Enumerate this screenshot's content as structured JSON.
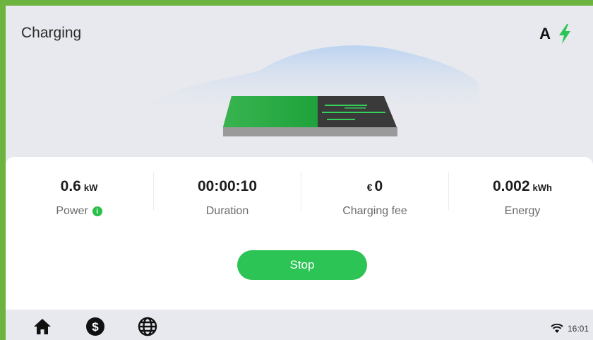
{
  "header": {
    "title": "Charging",
    "connector_letter": "A",
    "bolt_icon": "lightning-bolt-icon"
  },
  "metrics": [
    {
      "value": "0.6",
      "unit": "kW",
      "label": "Power",
      "info_icon": "info-icon"
    },
    {
      "value": "00:00:10",
      "unit": "",
      "label": "Duration"
    },
    {
      "value": "0",
      "currency": "€",
      "label": "Charging fee"
    },
    {
      "value": "0.002",
      "unit": "kWh",
      "label": "Energy"
    }
  ],
  "actions": {
    "stop_label": "Stop"
  },
  "nav": {
    "items": [
      "home-icon",
      "dollar-icon",
      "globe-icon"
    ]
  },
  "status_bar": {
    "time": "16:01",
    "wifi_icon": "wifi-icon"
  },
  "colors": {
    "accent": "#2cc454",
    "frame": "#6db33f",
    "background": "#e7e9ee"
  }
}
